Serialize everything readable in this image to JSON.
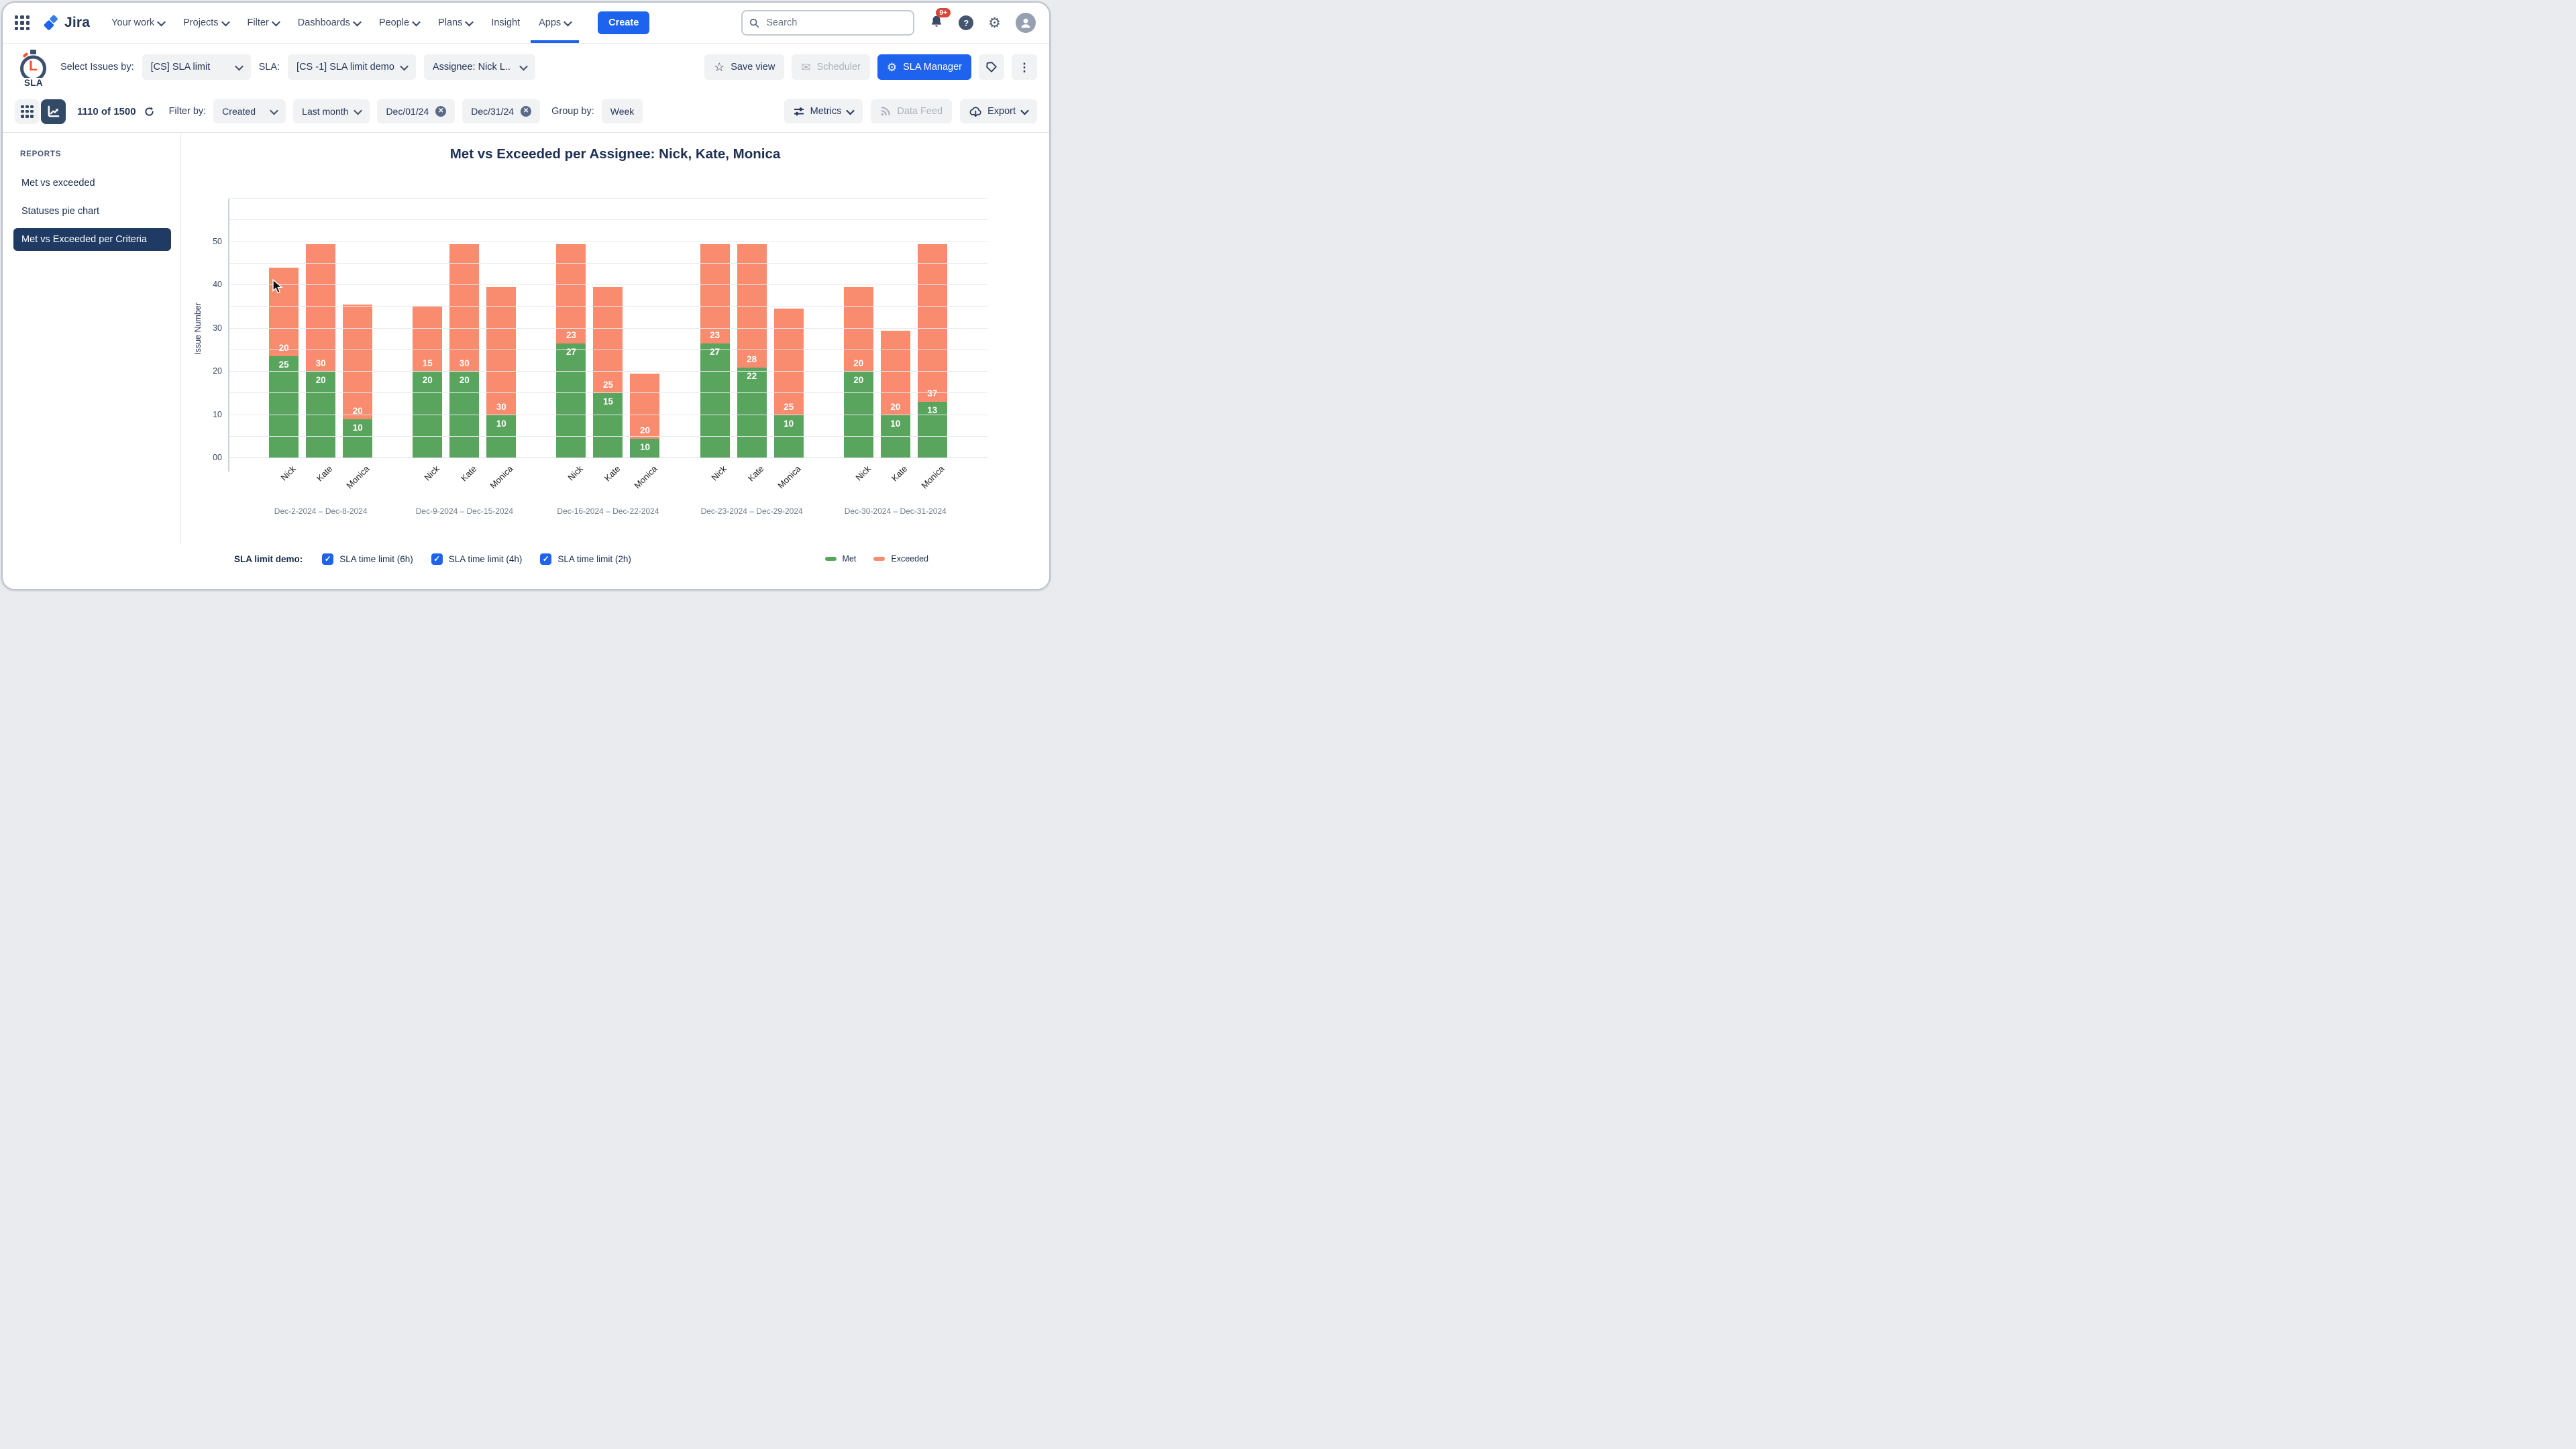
{
  "colors": {
    "accent_blue": "#1d63ed",
    "navy_text": "#172b4d",
    "met_green": "#5aa55e",
    "exceeded_salmon": "#f98b6e",
    "chip_bg": "#f1f2f4",
    "selected_navy": "#1f3a63",
    "toggle_navy": "#334a66",
    "badge_red": "#d6473c",
    "disabled_gray": "#a9b2c0"
  },
  "nav": {
    "brand": "Jira",
    "items": [
      {
        "label": "Your work",
        "caret": true,
        "active": false
      },
      {
        "label": "Projects",
        "caret": true,
        "active": false
      },
      {
        "label": "Filter",
        "caret": true,
        "active": false
      },
      {
        "label": "Dashboards",
        "caret": true,
        "active": false
      },
      {
        "label": "People",
        "caret": true,
        "active": false
      },
      {
        "label": "Plans",
        "caret": true,
        "active": false
      },
      {
        "label": "Insight",
        "caret": false,
        "active": false
      },
      {
        "label": "Apps",
        "caret": true,
        "active": true
      }
    ],
    "create_label": "Create",
    "search_placeholder": "Search",
    "notifications_badge": "9+",
    "help_glyph": "?"
  },
  "toolbar": {
    "app_logo_letter": "L",
    "app_logo_word": "SLA",
    "select_issues_label": "Select Issues by:",
    "select_issues_value": "[CS] SLA limit",
    "sla_label": "SLA:",
    "sla_value": "[CS -1] SLA limit demo",
    "assignee_value": "Assignee: Nick L..",
    "save_view_label": "Save view",
    "scheduler_label": "Scheduler",
    "sla_manager_label": "SLA Manager"
  },
  "filterbar": {
    "count": "1110 of 1500",
    "filter_by_label": "Filter by:",
    "field_value": "Created",
    "range_value": "Last month",
    "date_from": "Dec/01/24",
    "date_to": "Dec/31/24",
    "group_by_label": "Group by:",
    "group_value": "Week",
    "metrics_label": "Metrics",
    "data_feed_label": "Data Feed",
    "export_label": "Export"
  },
  "sidebar": {
    "header": "REPORTS",
    "items": [
      "Met vs exceeded",
      "Statuses pie chart",
      "Met vs Exceeded per Criteria"
    ],
    "active_index": 2
  },
  "chart_data": {
    "type": "bar",
    "stacked": true,
    "title": "Met vs Exceeded per Assignee: Nick, Kate, Monica",
    "ylabel": "Issue Number",
    "y_ticks": [
      "00",
      "10",
      "20",
      "30",
      "40",
      "50"
    ],
    "y_axis_max_units": 60,
    "gridline_step": 5,
    "legend_position": "bottom-right",
    "legend": [
      {
        "label": "Met",
        "color": "#5aa55e"
      },
      {
        "label": "Exceeded",
        "color": "#f98b6e"
      }
    ],
    "series_names": [
      "Met",
      "Exceeded"
    ],
    "groups": [
      {
        "label": "Dec-2-2024 – Dec-8-2024",
        "bars": [
          {
            "name": "Nick",
            "met": 25,
            "exceeded": 20,
            "met_units": 23.5,
            "exceeded_units": 20.5
          },
          {
            "name": "Kate",
            "met": 20,
            "exceeded": 30,
            "met_units": 20,
            "exceeded_units": 29.5
          },
          {
            "name": "Monica",
            "met": 10,
            "exceeded": 20,
            "met_units": 9,
            "exceeded_units": 26.5
          }
        ]
      },
      {
        "label": "Dec-9-2024 – Dec-15-2024",
        "bars": [
          {
            "name": "Nick",
            "met": 20,
            "exceeded": 15,
            "met_units": 20,
            "exceeded_units": 15
          },
          {
            "name": "Kate",
            "met": 20,
            "exceeded": 30,
            "met_units": 20,
            "exceeded_units": 29.5
          },
          {
            "name": "Monica",
            "met": 10,
            "exceeded": 30,
            "met_units": 10,
            "exceeded_units": 29.5
          }
        ]
      },
      {
        "label": "Dec-16-2024 – Dec-22-2024",
        "bars": [
          {
            "name": "Nick",
            "met": 27,
            "exceeded": 23,
            "met_units": 26.5,
            "exceeded_units": 23
          },
          {
            "name": "Kate",
            "met": 15,
            "exceeded": 25,
            "met_units": 15,
            "exceeded_units": 24.5
          },
          {
            "name": "Monica",
            "met": 10,
            "exceeded": 20,
            "met_units": 4.5,
            "exceeded_units": 15
          }
        ]
      },
      {
        "label": "Dec-23-2024 – Dec-29-2024",
        "bars": [
          {
            "name": "Nick",
            "met": 27,
            "exceeded": 23,
            "met_units": 26.5,
            "exceeded_units": 23
          },
          {
            "name": "Kate",
            "met": 22,
            "exceeded": 28,
            "met_units": 21,
            "exceeded_units": 28.5
          },
          {
            "name": "Monica",
            "met": 10,
            "exceeded": 25,
            "met_units": 10,
            "exceeded_units": 24.5
          }
        ]
      },
      {
        "label": "Dec-30-2024 – Dec-31-2024",
        "bars": [
          {
            "name": "Nick",
            "met": 20,
            "exceeded": 20,
            "met_units": 20,
            "exceeded_units": 19.5
          },
          {
            "name": "Kate",
            "met": 10,
            "exceeded": 20,
            "met_units": 10,
            "exceeded_units": 19.5
          },
          {
            "name": "Monica",
            "met": 13,
            "exceeded": 37,
            "met_units": 13,
            "exceeded_units": 36.5
          }
        ]
      }
    ]
  },
  "chart_footer": {
    "label": "SLA limit demo:",
    "checkboxes": [
      {
        "label": "SLA time limit (6h)",
        "checked": true
      },
      {
        "label": "SLA time limit (4h)",
        "checked": true
      },
      {
        "label": "SLA time limit (2h)",
        "checked": true
      }
    ]
  },
  "icons": {
    "app-switcher-icon": "3x3 dot grid",
    "search-icon": "magnifier",
    "notifications-icon": "bell",
    "help-icon": "?",
    "settings-icon": "gear",
    "avatar-icon": "person",
    "stopwatch-icon": "SLA stopwatch logo",
    "star-icon": "star outline",
    "mail-icon": "envelope",
    "tag-icon": "label tag",
    "kebab-icon": "vertical dots",
    "refresh-icon": "circular arrow",
    "sliders-icon": "metric sliders",
    "rss-icon": "data feed",
    "cloud-download-icon": "export",
    "close-icon": "circled x",
    "check-icon": "checkmark",
    "chevron-down-icon": "caret"
  }
}
